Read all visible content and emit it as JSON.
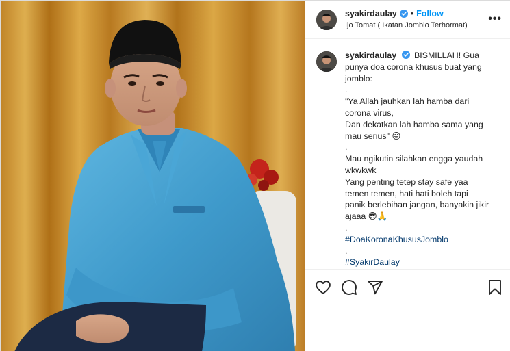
{
  "post": {
    "author": {
      "username": "syakirdaulay",
      "verified": true,
      "follow_label": "Follow",
      "separator": "•"
    },
    "location": "Ijo Tomat ( Ikatan Jomblo Terhormat)",
    "more_label": "•••",
    "caption": {
      "lines": [
        "BISMILLAH! Gua",
        "punya doa corona khusus buat yang",
        "jomblo:",
        ".",
        "\"Ya Allah jauhkan lah hamba dari",
        "corona virus,",
        "Dan dekatkan lah hamba sama yang",
        "mau serius\" 😛",
        ".",
        "Mau ngikutin silahkan engga yaudah",
        "wkwkwk",
        "Yang penting tetep stay safe yaa",
        "temen temen, hati hati boleh tapi",
        "panik berlebihan jangan, banyakin jikir",
        "ajaaa 😎🙏",
        "."
      ],
      "hashtags": [
        "#DoaKoronaKhususJomblo",
        ".",
        "#SyakirDaulay"
      ]
    }
  },
  "colors": {
    "link": "#0095f6",
    "hashtag": "#00376b",
    "text": "#262626",
    "verified_badge": "#3897f0"
  },
  "icons": {
    "like": "heart-icon",
    "comment": "comment-icon",
    "share": "paper-plane-icon",
    "save": "bookmark-icon",
    "verified": "verified-badge-icon"
  }
}
